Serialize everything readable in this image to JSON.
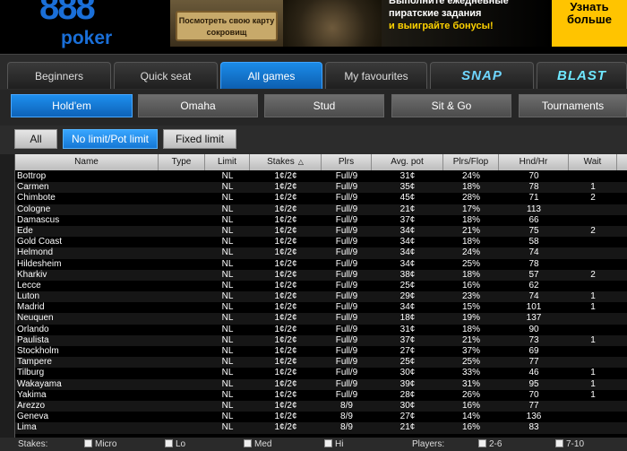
{
  "header": {
    "logo_number": "888",
    "logo_word": "poker",
    "banner1_text": "Посмотреть свою карту сокровищ",
    "banner2_line1": "Выполните ежедневные",
    "banner2_line2": "пиратские задания",
    "banner2_line3": "и выиграйте бонусы!",
    "banner3_text": "Узнать больше"
  },
  "tabs": [
    {
      "label": "Beginners"
    },
    {
      "label": "Quick seat"
    },
    {
      "label": "All games"
    },
    {
      "label": "My favourites"
    },
    {
      "label": "SNAP"
    },
    {
      "label": "BLAST"
    }
  ],
  "games": [
    {
      "label": "Hold'em"
    },
    {
      "label": "Omaha"
    },
    {
      "label": "Stud"
    },
    {
      "label": "Sit & Go"
    },
    {
      "label": "Tournaments"
    }
  ],
  "filters": [
    {
      "label": "All"
    },
    {
      "label": "No limit/Pot limit"
    },
    {
      "label": "Fixed limit"
    }
  ],
  "table": {
    "headers": {
      "name": "Name",
      "type": "Type",
      "limit": "Limit",
      "stakes": "Stakes",
      "plrs": "Plrs",
      "avg_pot": "Avg. pot",
      "plrs_flop": "Plrs/Flop",
      "hnd_hr": "Hnd/Hr",
      "wait": "Wait"
    },
    "sort_indicator": "△",
    "rows": [
      {
        "name": "Bottrop",
        "type": "",
        "limit": "NL",
        "stakes": "1¢/2¢",
        "plrs": "Full/9",
        "avg": "31¢",
        "flop": "24%",
        "hnd": "70",
        "wait": ""
      },
      {
        "name": "Carmen",
        "type": "",
        "limit": "NL",
        "stakes": "1¢/2¢",
        "plrs": "Full/9",
        "avg": "35¢",
        "flop": "18%",
        "hnd": "78",
        "wait": "1"
      },
      {
        "name": "Chimbote",
        "type": "",
        "limit": "NL",
        "stakes": "1¢/2¢",
        "plrs": "Full/9",
        "avg": "45¢",
        "flop": "28%",
        "hnd": "71",
        "wait": "2"
      },
      {
        "name": "Cologne",
        "type": "",
        "limit": "NL",
        "stakes": "1¢/2¢",
        "plrs": "Full/9",
        "avg": "21¢",
        "flop": "17%",
        "hnd": "113",
        "wait": ""
      },
      {
        "name": "Damascus",
        "type": "",
        "limit": "NL",
        "stakes": "1¢/2¢",
        "plrs": "Full/9",
        "avg": "37¢",
        "flop": "18%",
        "hnd": "66",
        "wait": ""
      },
      {
        "name": "Ede",
        "type": "",
        "limit": "NL",
        "stakes": "1¢/2¢",
        "plrs": "Full/9",
        "avg": "34¢",
        "flop": "21%",
        "hnd": "75",
        "wait": "2"
      },
      {
        "name": "Gold Coast",
        "type": "",
        "limit": "NL",
        "stakes": "1¢/2¢",
        "plrs": "Full/9",
        "avg": "34¢",
        "flop": "18%",
        "hnd": "58",
        "wait": ""
      },
      {
        "name": "Helmond",
        "type": "",
        "limit": "NL",
        "stakes": "1¢/2¢",
        "plrs": "Full/9",
        "avg": "34¢",
        "flop": "24%",
        "hnd": "74",
        "wait": ""
      },
      {
        "name": "Hildesheim",
        "type": "",
        "limit": "NL",
        "stakes": "1¢/2¢",
        "plrs": "Full/9",
        "avg": "34¢",
        "flop": "25%",
        "hnd": "78",
        "wait": ""
      },
      {
        "name": "Kharkiv",
        "type": "",
        "limit": "NL",
        "stakes": "1¢/2¢",
        "plrs": "Full/9",
        "avg": "38¢",
        "flop": "18%",
        "hnd": "57",
        "wait": "2"
      },
      {
        "name": "Lecce",
        "type": "",
        "limit": "NL",
        "stakes": "1¢/2¢",
        "plrs": "Full/9",
        "avg": "25¢",
        "flop": "16%",
        "hnd": "62",
        "wait": ""
      },
      {
        "name": "Luton",
        "type": "",
        "limit": "NL",
        "stakes": "1¢/2¢",
        "plrs": "Full/9",
        "avg": "29¢",
        "flop": "23%",
        "hnd": "74",
        "wait": "1"
      },
      {
        "name": "Madrid",
        "type": "",
        "limit": "NL",
        "stakes": "1¢/2¢",
        "plrs": "Full/9",
        "avg": "34¢",
        "flop": "15%",
        "hnd": "101",
        "wait": "1"
      },
      {
        "name": "Neuquen",
        "type": "",
        "limit": "NL",
        "stakes": "1¢/2¢",
        "plrs": "Full/9",
        "avg": "18¢",
        "flop": "19%",
        "hnd": "137",
        "wait": ""
      },
      {
        "name": "Orlando",
        "type": "",
        "limit": "NL",
        "stakes": "1¢/2¢",
        "plrs": "Full/9",
        "avg": "31¢",
        "flop": "18%",
        "hnd": "90",
        "wait": ""
      },
      {
        "name": "Paulista",
        "type": "",
        "limit": "NL",
        "stakes": "1¢/2¢",
        "plrs": "Full/9",
        "avg": "37¢",
        "flop": "21%",
        "hnd": "73",
        "wait": "1"
      },
      {
        "name": "Stockholm",
        "type": "",
        "limit": "NL",
        "stakes": "1¢/2¢",
        "plrs": "Full/9",
        "avg": "27¢",
        "flop": "37%",
        "hnd": "69",
        "wait": ""
      },
      {
        "name": "Tampere",
        "type": "",
        "limit": "NL",
        "stakes": "1¢/2¢",
        "plrs": "Full/9",
        "avg": "25¢",
        "flop": "25%",
        "hnd": "77",
        "wait": ""
      },
      {
        "name": "Tilburg",
        "type": "",
        "limit": "NL",
        "stakes": "1¢/2¢",
        "plrs": "Full/9",
        "avg": "30¢",
        "flop": "33%",
        "hnd": "46",
        "wait": "1"
      },
      {
        "name": "Wakayama",
        "type": "",
        "limit": "NL",
        "stakes": "1¢/2¢",
        "plrs": "Full/9",
        "avg": "39¢",
        "flop": "31%",
        "hnd": "95",
        "wait": "1"
      },
      {
        "name": "Yakima",
        "type": "",
        "limit": "NL",
        "stakes": "1¢/2¢",
        "plrs": "Full/9",
        "avg": "28¢",
        "flop": "26%",
        "hnd": "70",
        "wait": "1"
      },
      {
        "name": "Arezzo",
        "type": "",
        "limit": "NL",
        "stakes": "1¢/2¢",
        "plrs": "8/9",
        "avg": "30¢",
        "flop": "16%",
        "hnd": "77",
        "wait": ""
      },
      {
        "name": "Geneva",
        "type": "",
        "limit": "NL",
        "stakes": "1¢/2¢",
        "plrs": "8/9",
        "avg": "27¢",
        "flop": "14%",
        "hnd": "136",
        "wait": ""
      },
      {
        "name": "Lima",
        "type": "",
        "limit": "NL",
        "stakes": "1¢/2¢",
        "plrs": "8/9",
        "avg": "21¢",
        "flop": "16%",
        "hnd": "83",
        "wait": ""
      }
    ]
  },
  "bottom": {
    "stakes_label": "Stakes:",
    "micro_label": "Micro",
    "lo_label": "Lo",
    "med_label": "Med",
    "hi_label": "Hi",
    "players_label": "Players:",
    "range1_label": "2-6",
    "range2_label": "7-10"
  }
}
